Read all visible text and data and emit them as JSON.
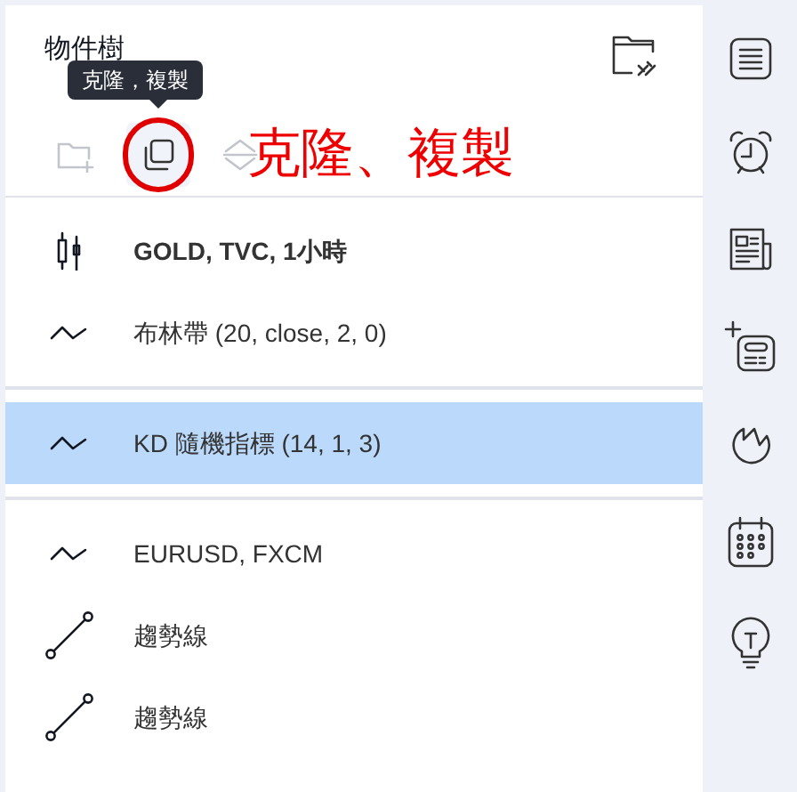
{
  "panel": {
    "title": "物件樹"
  },
  "toolbar": [
    {
      "kind": "new-folder",
      "disabled": true,
      "highlighted": false
    },
    {
      "kind": "clone",
      "disabled": false,
      "highlighted": true
    },
    {
      "kind": "move",
      "disabled": true,
      "highlighted": false
    }
  ],
  "tooltip": "克隆，複製",
  "annotation": "克隆、複製",
  "groups": [
    {
      "items": [
        {
          "kind": "main-series",
          "label": "GOLD, TVC, 1小時",
          "selected": false
        },
        {
          "kind": "indicator",
          "label": "布林帶 (20, close, 2, 0)",
          "selected": false
        }
      ]
    },
    {
      "items": [
        {
          "kind": "indicator",
          "label": "KD 隨機指標 (14, 1, 3)",
          "selected": true
        }
      ]
    },
    {
      "items": [
        {
          "kind": "indicator",
          "label": "EURUSD, FXCM",
          "selected": false
        },
        {
          "kind": "trend-line",
          "label": "趨勢線",
          "selected": false
        },
        {
          "kind": "trend-line",
          "label": "趨勢線",
          "selected": false
        }
      ]
    }
  ]
}
